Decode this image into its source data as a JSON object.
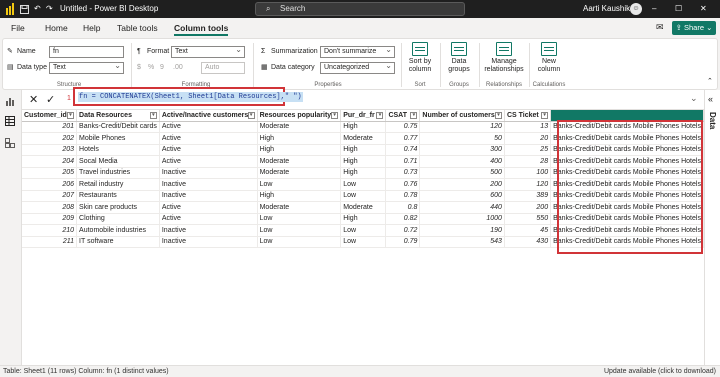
{
  "titlebar": {
    "title": "Untitled - Power BI Desktop",
    "search_placeholder": "Search",
    "user_name": "Aarti Kaushik"
  },
  "menu": {
    "tabs": [
      "File",
      "Home",
      "Help",
      "Table tools",
      "Column tools"
    ],
    "active_tab": "Column tools",
    "share_label": "Share"
  },
  "ribbon": {
    "name_label": "Name",
    "name_value": "fn",
    "datatype_label": "Data type",
    "datatype_value": "Text",
    "format_label": "Format",
    "format_value": "Text",
    "currency_symbol": "$",
    "percent_symbol": "%",
    "comma_symbol": "9",
    "decimals_value": "Auto",
    "summarization_label": "Summarization",
    "summarization_value": "Don't summarize",
    "category_label": "Data category",
    "category_value": "Uncategorized",
    "sort_label": "Sort by column",
    "groups_label": "Data groups",
    "manage_label": "Manage relationships",
    "newcol_label": "New column",
    "group_structure": "Structure",
    "group_formatting": "Formatting",
    "group_properties": "Properties",
    "group_sort": "Sort",
    "group_groups": "Groups",
    "group_relationships": "Relationships",
    "group_calculations": "Calculations"
  },
  "formula": {
    "line_number": "1",
    "text": "fn = CONCATENATEX(Sheet1, Sheet1[Data Resources],\" \")"
  },
  "datapane": {
    "label": "Data"
  },
  "table": {
    "columns": [
      "Customer_id",
      "Data Resources",
      "Active/Inactive customers",
      "Resources popularity",
      "Pur_dr_fr",
      "CSAT",
      "Number of customers",
      "CS Ticket",
      "fn"
    ],
    "fn_value": "Banks-Credit/Debit cards Mobile Phones Hotels",
    "rows": [
      [
        "201",
        "Banks-Credit/Debit cards",
        "Active",
        "Moderate",
        "High",
        "0.75",
        "120",
        "13"
      ],
      [
        "202",
        "Mobile Phones",
        "Active",
        "High",
        "Moderate",
        "0.77",
        "50",
        "20"
      ],
      [
        "203",
        "Hotels",
        "Active",
        "High",
        "High",
        "0.74",
        "300",
        "25"
      ],
      [
        "204",
        "Socal Media",
        "Active",
        "Moderate",
        "High",
        "0.71",
        "400",
        "28"
      ],
      [
        "205",
        "Travel industries",
        "Inactive",
        "Moderate",
        "High",
        "0.73",
        "500",
        "100"
      ],
      [
        "206",
        "Retail industry",
        "Inactive",
        "Low",
        "Low",
        "0.76",
        "200",
        "120"
      ],
      [
        "207",
        "Restaurants",
        "Inactive",
        "High",
        "Low",
        "0.78",
        "600",
        "389"
      ],
      [
        "208",
        "Skin care products",
        "Active",
        "Moderate",
        "Moderate",
        "0.8",
        "440",
        "200"
      ],
      [
        "209",
        "Clothing",
        "Active",
        "Low",
        "High",
        "0.82",
        "1000",
        "550"
      ],
      [
        "210",
        "Automobile industries",
        "Inactive",
        "Low",
        "Low",
        "0.72",
        "190",
        "45"
      ],
      [
        "211",
        "IT software",
        "Inactive",
        "Low",
        "Low",
        "0.79",
        "543",
        "430"
      ]
    ]
  },
  "status": {
    "left": "Table: Sheet1 (11 rows) Column: fn (1 distinct values)",
    "right": "Update available (click to download)"
  },
  "colors": {
    "accent": "#117865",
    "highlight": "#d13438",
    "titlebar": "#1f1f1f"
  }
}
